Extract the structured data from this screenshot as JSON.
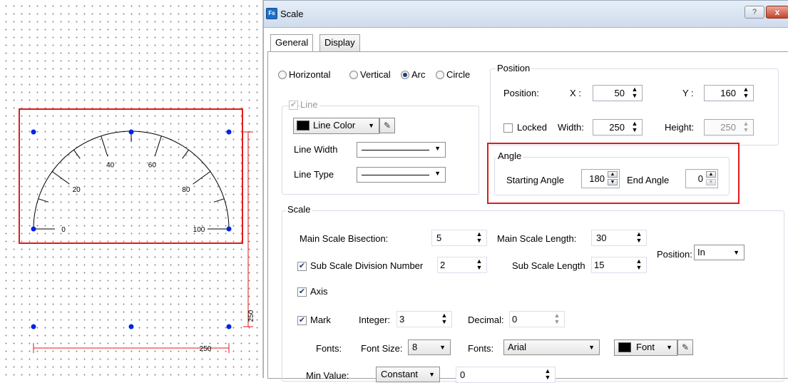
{
  "canvas": {
    "scale_labels": [
      "0",
      "20",
      "40",
      "60",
      "80",
      "100"
    ],
    "dim_width": "250",
    "dim_height": "250",
    "handle_color": "#0022ee",
    "selection_color": "#e21a1a"
  },
  "dialog": {
    "title": "Scale",
    "icon_text": "Fs",
    "help": "?",
    "close": "x"
  },
  "tabs": [
    "General",
    "Display"
  ],
  "orientation": {
    "options": [
      "Horizontal",
      "Vertical",
      "Arc",
      "Circle"
    ],
    "selected": "Arc"
  },
  "line": {
    "title": "Line",
    "checked": true,
    "color_label": "Line Color",
    "width_label": "Line Width",
    "type_label": "Line Type"
  },
  "position": {
    "title": "Position",
    "label": "Position:",
    "x_label": "X :",
    "x": "50",
    "y_label": "Y :",
    "y": "160",
    "locked_label": "Locked",
    "locked": false,
    "width_label": "Width:",
    "width": "250",
    "height_label": "Height:",
    "height": "250"
  },
  "angle": {
    "title": "Angle",
    "start_label": "Starting Angle",
    "start": "180",
    "end_label": "End Angle",
    "end": "0"
  },
  "scale": {
    "title": "Scale",
    "main_bisection_label": "Main Scale Bisection:",
    "main_bisection": "5",
    "main_length_label": "Main Scale Length:",
    "main_length": "30",
    "position_label": "Position:",
    "position": "In",
    "sub_division_label": "Sub Scale Division Number",
    "sub_division": "2",
    "sub_length_label": "Sub Scale Length",
    "sub_length": "15",
    "axis_label": "Axis",
    "mark_label": "Mark",
    "integer_label": "Integer:",
    "integer": "3",
    "decimal_label": "Decimal:",
    "decimal": "0",
    "fonts_label": "Fonts:",
    "font_size_label": "Font Size:",
    "font_size": "8",
    "font_name_label": "Fonts:",
    "font_name": "Arial",
    "font_btn_label": "Font",
    "min_label": "Min Value:",
    "min_mode": "Constant",
    "min_value": "0"
  }
}
